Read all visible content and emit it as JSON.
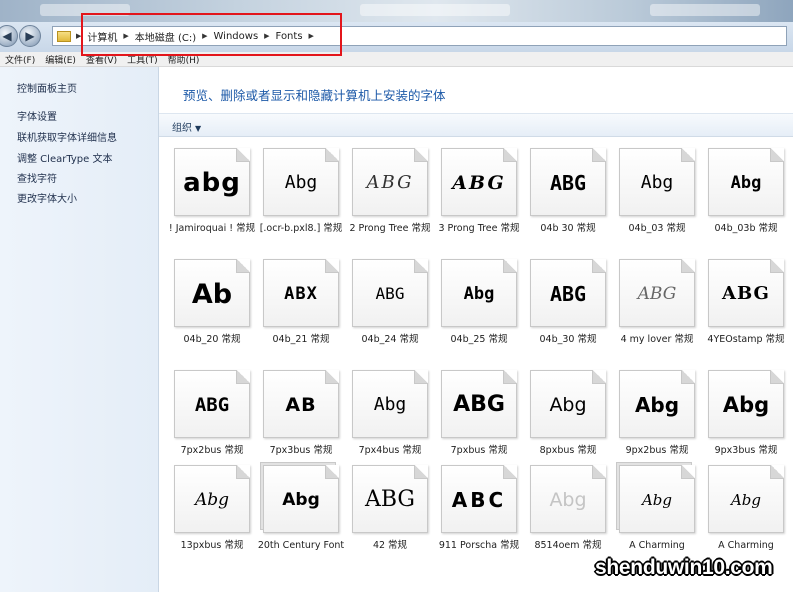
{
  "address_bar": {
    "crumbs": [
      "计算机",
      "本地磁盘 (C:)",
      "Windows",
      "Fonts"
    ]
  },
  "menu": [
    "文件(F)",
    "编辑(E)",
    "查看(V)",
    "工具(T)",
    "帮助(H)"
  ],
  "sidebar": {
    "links": [
      "控制面板主页",
      "字体设置",
      "联机获取字体详细信息",
      "调整 ClearType 文本",
      "查找字符",
      "更改字体大小"
    ]
  },
  "main": {
    "title": "预览、删除或者显示和隐藏计算机上安装的字体",
    "organize_label": "组织"
  },
  "fonts": [
    {
      "sample": "abg",
      "name": "! Jamiroquai ! 常规"
    },
    {
      "sample": "Abg",
      "name": "[.ocr-b.pxl8.] 常规"
    },
    {
      "sample": "ABG",
      "name": "2 Prong Tree 常规"
    },
    {
      "sample": "ABG",
      "name": "3 Prong Tree 常规"
    },
    {
      "sample": "ABG",
      "name": "04b 30 常规"
    },
    {
      "sample": "Abg",
      "name": "04b_03 常规"
    },
    {
      "sample": "Abg",
      "name": "04b_03b 常规"
    },
    {
      "sample": "Ab",
      "name": "04b_20 常规"
    },
    {
      "sample": "ABX",
      "name": "04b_21 常规"
    },
    {
      "sample": "ABG",
      "name": "04b_24 常规"
    },
    {
      "sample": "Abg",
      "name": "04b_25 常规"
    },
    {
      "sample": "ABG",
      "name": "04b_30 常规"
    },
    {
      "sample": "ABG",
      "name": "4 my lover 常规"
    },
    {
      "sample": "ABG",
      "name": "4YEOstamp 常规"
    },
    {
      "sample": "ABG",
      "name": "7px2bus 常规"
    },
    {
      "sample": "AB",
      "name": "7px3bus 常规"
    },
    {
      "sample": "Abg",
      "name": "7px4bus 常规"
    },
    {
      "sample": "ABG",
      "name": "7pxbus 常规"
    },
    {
      "sample": "Abg",
      "name": "8pxbus 常规"
    },
    {
      "sample": "Abg",
      "name": "9px2bus 常规"
    },
    {
      "sample": "Abg",
      "name": "9px3bus 常规"
    },
    {
      "sample": "Abg",
      "name": "13pxbus 常规"
    },
    {
      "sample": "Abg",
      "name": "20th Century Font"
    },
    {
      "sample": "ABG",
      "name": "42 常规"
    },
    {
      "sample": "ABC",
      "name": "911 Porscha 常规"
    },
    {
      "sample": "Abg",
      "name": "8514oem 常规"
    },
    {
      "sample": "Abg",
      "name": "A Charming"
    },
    {
      "sample": "Abg",
      "name": "A Charming"
    }
  ],
  "watermark": "shenduwin10.com"
}
